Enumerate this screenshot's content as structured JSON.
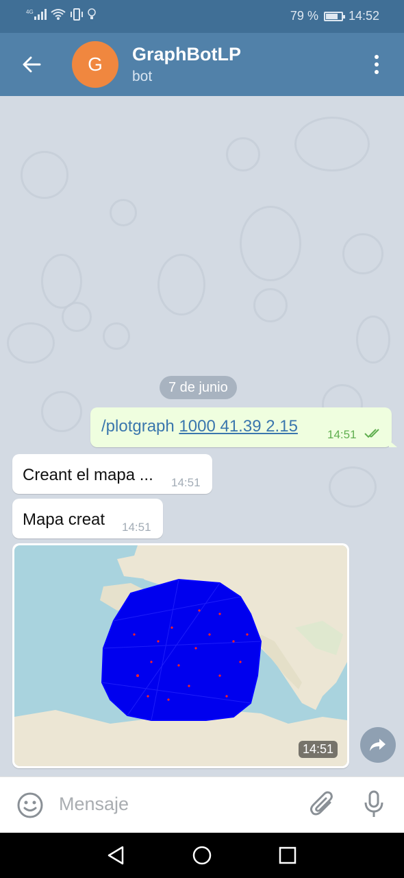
{
  "status_bar": {
    "network": "4G",
    "battery_percent": "79 %",
    "battery_level": 0.79,
    "time": "14:52"
  },
  "header": {
    "back_icon": "arrow-left-icon",
    "avatar_letter": "G",
    "avatar_color": "#f0873f",
    "title": "GraphBotLP",
    "subtitle": "bot",
    "menu_icon": "more-vertical-icon",
    "background": "#5181a9"
  },
  "chat": {
    "date_separator": "7 de junio",
    "outgoing": {
      "command": "/plotgraph",
      "args": "1000 41.39 2.15",
      "time": "14:51",
      "status": "read"
    },
    "incoming": [
      {
        "text": "Creant el mapa ...",
        "time": "14:51"
      },
      {
        "text": "Mapa creat",
        "time": "14:51"
      }
    ],
    "photo": {
      "description_icon": "map-graph-image",
      "time": "14:51"
    },
    "share_icon": "share-icon"
  },
  "input_bar": {
    "placeholder": "Mensaje",
    "emoji_icon": "emoji-icon",
    "attach_icon": "paperclip-icon",
    "mic_icon": "microphone-icon"
  },
  "nav_bar": {
    "back_icon": "triangle-back-icon",
    "home_icon": "circle-home-icon",
    "recents_icon": "square-recents-icon"
  }
}
